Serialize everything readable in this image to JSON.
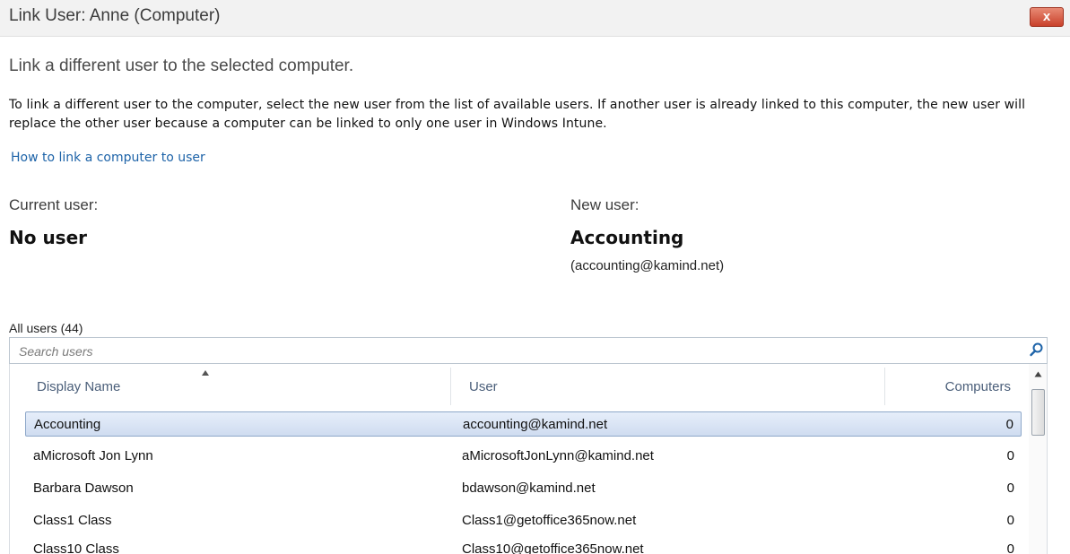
{
  "window": {
    "title": "Link User: Anne (Computer)",
    "close_label": "x"
  },
  "subtitle": "Link a different user to the selected computer.",
  "description": "To link a different user to the computer, select the new user from the list of available users. If another user is already linked to this computer, the new user will replace the other user because a computer can be linked to only one user in Windows Intune.",
  "help_link": "How to link a computer to user",
  "current_user": {
    "label": "Current user:",
    "name": "No user"
  },
  "new_user": {
    "label": "New user:",
    "name": "Accounting",
    "email": "(accounting@kamind.net)"
  },
  "users_list": {
    "count_label": "All users (44)",
    "search_placeholder": "Search users",
    "columns": [
      "Display Name",
      "User",
      "Computers"
    ],
    "sort_column": "Display Name",
    "rows": [
      {
        "display_name": "Accounting",
        "user": "accounting@kamind.net",
        "computers": "0",
        "selected": true
      },
      {
        "display_name": "aMicrosoft Jon Lynn",
        "user": "aMicrosoftJonLynn@kamind.net",
        "computers": "0",
        "selected": false
      },
      {
        "display_name": "Barbara Dawson",
        "user": "bdawson@kamind.net",
        "computers": "0",
        "selected": false
      },
      {
        "display_name": "Class1 Class",
        "user": "Class1@getoffice365now.net",
        "computers": "0",
        "selected": false
      },
      {
        "display_name": "Class10 Class",
        "user": "Class10@getoffice365now.net",
        "computers": "0",
        "selected": false
      }
    ]
  },
  "icons": {
    "close": "close-icon",
    "search": "search-icon",
    "sort": "sort-ascending-icon",
    "scroll_up": "scroll-up-arrow-icon"
  },
  "colors": {
    "link": "#1d63a8",
    "close_button": "#c9412b",
    "selected_row": "#cfdcf0",
    "header_text": "#4b5f7a"
  }
}
